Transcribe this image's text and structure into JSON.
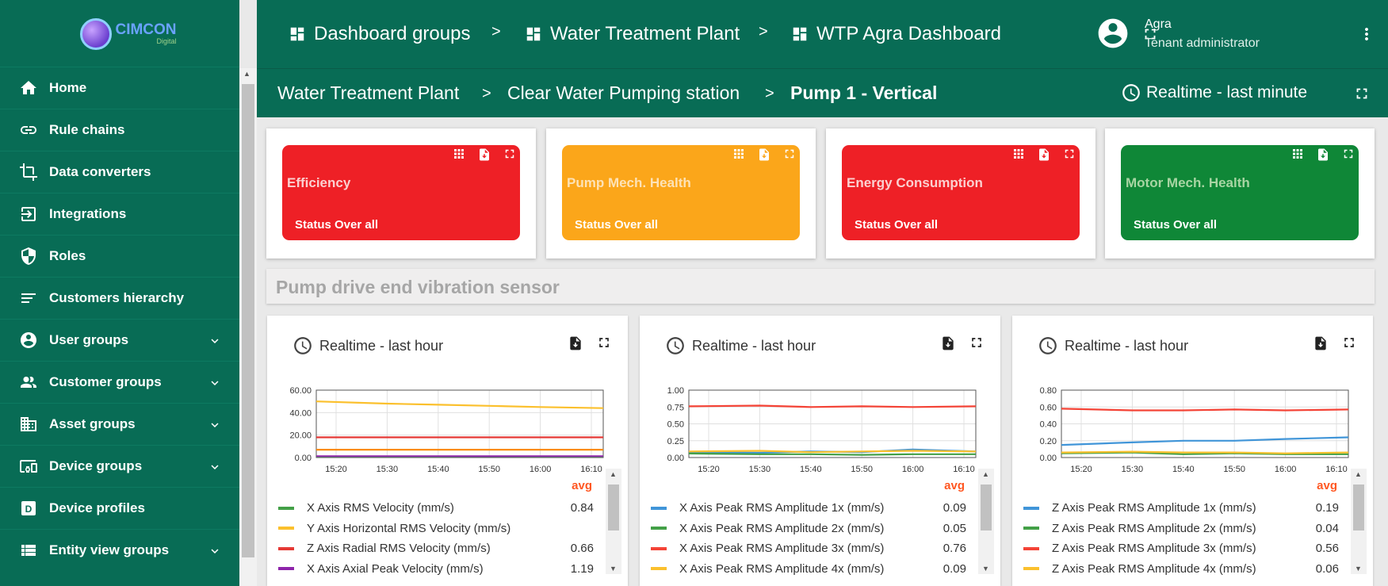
{
  "app": {
    "logo_text": "CIMCON",
    "logo_sub": "Digital"
  },
  "sidebar": {
    "items": [
      {
        "label": "Home",
        "icon": "home-icon",
        "expandable": false
      },
      {
        "label": "Rule chains",
        "icon": "rule-chains-icon",
        "expandable": false
      },
      {
        "label": "Data converters",
        "icon": "data-converters-icon",
        "expandable": false
      },
      {
        "label": "Integrations",
        "icon": "integrations-icon",
        "expandable": false
      },
      {
        "label": "Roles",
        "icon": "shield-icon",
        "expandable": false
      },
      {
        "label": "Customers hierarchy",
        "icon": "hierarchy-icon",
        "expandable": false
      },
      {
        "label": "User groups",
        "icon": "account-icon",
        "expandable": true
      },
      {
        "label": "Customer groups",
        "icon": "people-icon",
        "expandable": true
      },
      {
        "label": "Asset groups",
        "icon": "building-icon",
        "expandable": true
      },
      {
        "label": "Device groups",
        "icon": "devices-icon",
        "expandable": true
      },
      {
        "label": "Device profiles",
        "icon": "device-profile-icon",
        "expandable": false
      },
      {
        "label": "Entity view groups",
        "icon": "view-list-icon",
        "expandable": true
      }
    ]
  },
  "topbar": {
    "crumbs": [
      "Dashboard groups",
      "Water Treatment Plant",
      "WTP Agra Dashboard"
    ],
    "separator": ">",
    "user_name": "Agra",
    "user_role": "Tenant administrator"
  },
  "dashbar": {
    "crumbs": [
      "Water Treatment Plant",
      "Clear Water Pumping station",
      "Pump 1 - Vertical"
    ],
    "separator": ">",
    "timewindow": "Realtime - last minute"
  },
  "status_cards": [
    {
      "title": "Efficiency",
      "status": "Status Over all",
      "color": "#ee2026",
      "title_color": "#fbd0d0"
    },
    {
      "title": "Pump Mech. Health",
      "status": "Status Over all",
      "color": "#fba61a",
      "title_color": "#fde2b6"
    },
    {
      "title": "Energy Consumption",
      "status": "Status Over all",
      "color": "#ee2026",
      "title_color": "#fbd0d0"
    },
    {
      "title": "Motor Mech. Health",
      "status": "Status Over all",
      "color": "#0f8737",
      "title_color": "#a8d5a3"
    }
  ],
  "section_title": "Pump drive end vibration sensor",
  "panels": [
    {
      "timewindow": "Realtime - last hour",
      "avg_label": "avg",
      "legend": [
        {
          "name": "X Axis RMS Velocity (mm/s)",
          "avg": "0.84",
          "color": "#43a047"
        },
        {
          "name": "Y Axis Horizontal RMS Velocity (mm/s)",
          "avg": "",
          "color": "#fbc02d"
        },
        {
          "name": "Z Axis Radial RMS Velocity (mm/s)",
          "avg": "0.66",
          "color": "#e53935"
        },
        {
          "name": "X Axis Axial Peak Velocity (mm/s)",
          "avg": "1.19",
          "color": "#8e24aa"
        }
      ]
    },
    {
      "timewindow": "Realtime - last hour",
      "avg_label": "avg",
      "legend": [
        {
          "name": "X Axis Peak RMS Amplitude 1x (mm/s)",
          "avg": "0.09",
          "color": "#4095d8"
        },
        {
          "name": "X Axis Peak RMS Amplitude 2x (mm/s)",
          "avg": "0.05",
          "color": "#43a047"
        },
        {
          "name": "X Axis Peak RMS Amplitude 3x (mm/s)",
          "avg": "0.76",
          "color": "#f44336"
        },
        {
          "name": "X Axis Peak RMS Amplitude 4x (mm/s)",
          "avg": "0.09",
          "color": "#fbc02d"
        }
      ]
    },
    {
      "timewindow": "Realtime - last hour",
      "avg_label": "avg",
      "legend": [
        {
          "name": "Z Axis Peak RMS Amplitude 1x (mm/s)",
          "avg": "0.19",
          "color": "#4095d8"
        },
        {
          "name": "Z Axis Peak RMS Amplitude 2x (mm/s)",
          "avg": "0.04",
          "color": "#43a047"
        },
        {
          "name": "Z Axis Peak RMS Amplitude 3x (mm/s)",
          "avg": "0.56",
          "color": "#f44336"
        },
        {
          "name": "Z Axis Peak RMS Amplitude 4x (mm/s)",
          "avg": "0.06",
          "color": "#fbc02d"
        }
      ]
    }
  ],
  "chart_data": [
    {
      "type": "line",
      "x": [
        "15:20",
        "15:30",
        "15:40",
        "15:50",
        "16:00",
        "16:10"
      ],
      "yticks": [
        "0.00",
        "20.00",
        "40.00",
        "60.00"
      ],
      "ylim": [
        0,
        60
      ],
      "series": [
        {
          "name": "X Axis RMS Velocity (mm/s)",
          "color": "#43a047",
          "values": [
            0.8,
            0.8,
            0.8,
            0.9,
            0.8,
            0.8
          ]
        },
        {
          "name": "Y Axis Horizontal RMS Velocity (mm/s)",
          "color": "#fbc02d",
          "values": [
            50,
            48,
            47,
            46,
            45,
            44
          ]
        },
        {
          "name": "Z Axis Radial RMS Velocity (mm/s)",
          "color": "#e53935",
          "values": [
            18,
            18,
            18,
            18,
            18,
            18
          ]
        },
        {
          "name": "X Axis Axial Peak Velocity (mm/s)",
          "color": "#8e24aa",
          "values": [
            1.2,
            1.2,
            1.2,
            1.2,
            1.2,
            1.2
          ]
        },
        {
          "name": "",
          "color": "#fb8c00",
          "values": [
            7,
            7,
            7,
            7,
            7,
            7
          ]
        }
      ]
    },
    {
      "type": "line",
      "x": [
        "15:20",
        "15:30",
        "15:40",
        "15:50",
        "16:00",
        "16:10"
      ],
      "yticks": [
        "0.00",
        "0.25",
        "0.50",
        "0.75",
        "1.00"
      ],
      "ylim": [
        0,
        1
      ],
      "series": [
        {
          "name": "X Axis Peak RMS Amplitude 1x (mm/s)",
          "color": "#4095d8",
          "values": [
            0.08,
            0.07,
            0.09,
            0.08,
            0.12,
            0.09
          ]
        },
        {
          "name": "X Axis Peak RMS Amplitude 2x (mm/s)",
          "color": "#43a047",
          "values": [
            0.06,
            0.05,
            0.05,
            0.04,
            0.05,
            0.05
          ]
        },
        {
          "name": "X Axis Peak RMS Amplitude 3x (mm/s)",
          "color": "#f44336",
          "values": [
            0.76,
            0.77,
            0.75,
            0.76,
            0.75,
            0.76
          ]
        },
        {
          "name": "X Axis Peak RMS Amplitude 4x (mm/s)",
          "color": "#fbc02d",
          "values": [
            0.09,
            0.1,
            0.08,
            0.09,
            0.1,
            0.09
          ]
        }
      ]
    },
    {
      "type": "line",
      "x": [
        "15:20",
        "15:30",
        "15:40",
        "15:50",
        "16:00",
        "16:10"
      ],
      "yticks": [
        "0.00",
        "0.20",
        "0.40",
        "0.60",
        "0.80"
      ],
      "ylim": [
        0,
        0.8
      ],
      "series": [
        {
          "name": "Z Axis Peak RMS Amplitude 1x (mm/s)",
          "color": "#4095d8",
          "values": [
            0.15,
            0.18,
            0.2,
            0.2,
            0.22,
            0.24
          ]
        },
        {
          "name": "Z Axis Peak RMS Amplitude 2x (mm/s)",
          "color": "#43a047",
          "values": [
            0.05,
            0.06,
            0.04,
            0.05,
            0.04,
            0.04
          ]
        },
        {
          "name": "Z Axis Peak RMS Amplitude 3x (mm/s)",
          "color": "#f44336",
          "values": [
            0.58,
            0.56,
            0.56,
            0.57,
            0.56,
            0.57
          ]
        },
        {
          "name": "Z Axis Peak RMS Amplitude 4x (mm/s)",
          "color": "#fbc02d",
          "values": [
            0.06,
            0.07,
            0.06,
            0.06,
            0.05,
            0.06
          ]
        }
      ]
    }
  ]
}
